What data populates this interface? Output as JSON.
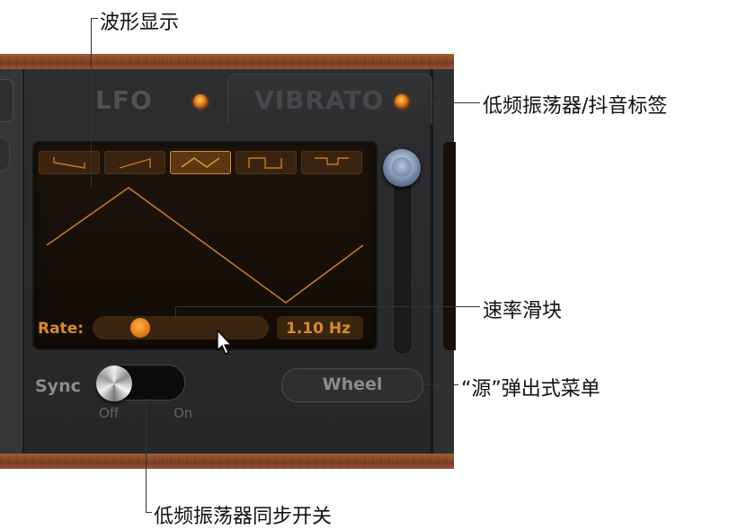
{
  "callouts": {
    "waveform_display": "波形显示",
    "lfo_vibrato_tabs": "低频振荡器/抖音标签",
    "rate_slider": "速率滑块",
    "source_popup": "“源”弹出式菜单",
    "lfo_sync_switch": "低频振荡器同步开关"
  },
  "tabs": [
    {
      "label": "LFO",
      "active": true
    },
    {
      "label": "VIBRATO",
      "active": false
    }
  ],
  "waveform_buttons": [
    {
      "icon": "ramp-down-wave-icon",
      "active": false
    },
    {
      "icon": "ramp-up-wave-icon",
      "active": false
    },
    {
      "icon": "triangle-wave-icon",
      "active": true
    },
    {
      "icon": "square-wave-icon",
      "active": false
    },
    {
      "icon": "pulse-wave-icon",
      "active": false
    }
  ],
  "rate": {
    "label": "Rate:",
    "value": "1.10 Hz"
  },
  "sync": {
    "label": "Sync",
    "off_label": "Off",
    "on_label": "On",
    "state": "off"
  },
  "source": {
    "value": "Wheel"
  },
  "colors": {
    "accent": "#d98a2a",
    "led": "#f08a1a",
    "panel": "#2a2b2c",
    "wood": "#8a4a2a"
  }
}
